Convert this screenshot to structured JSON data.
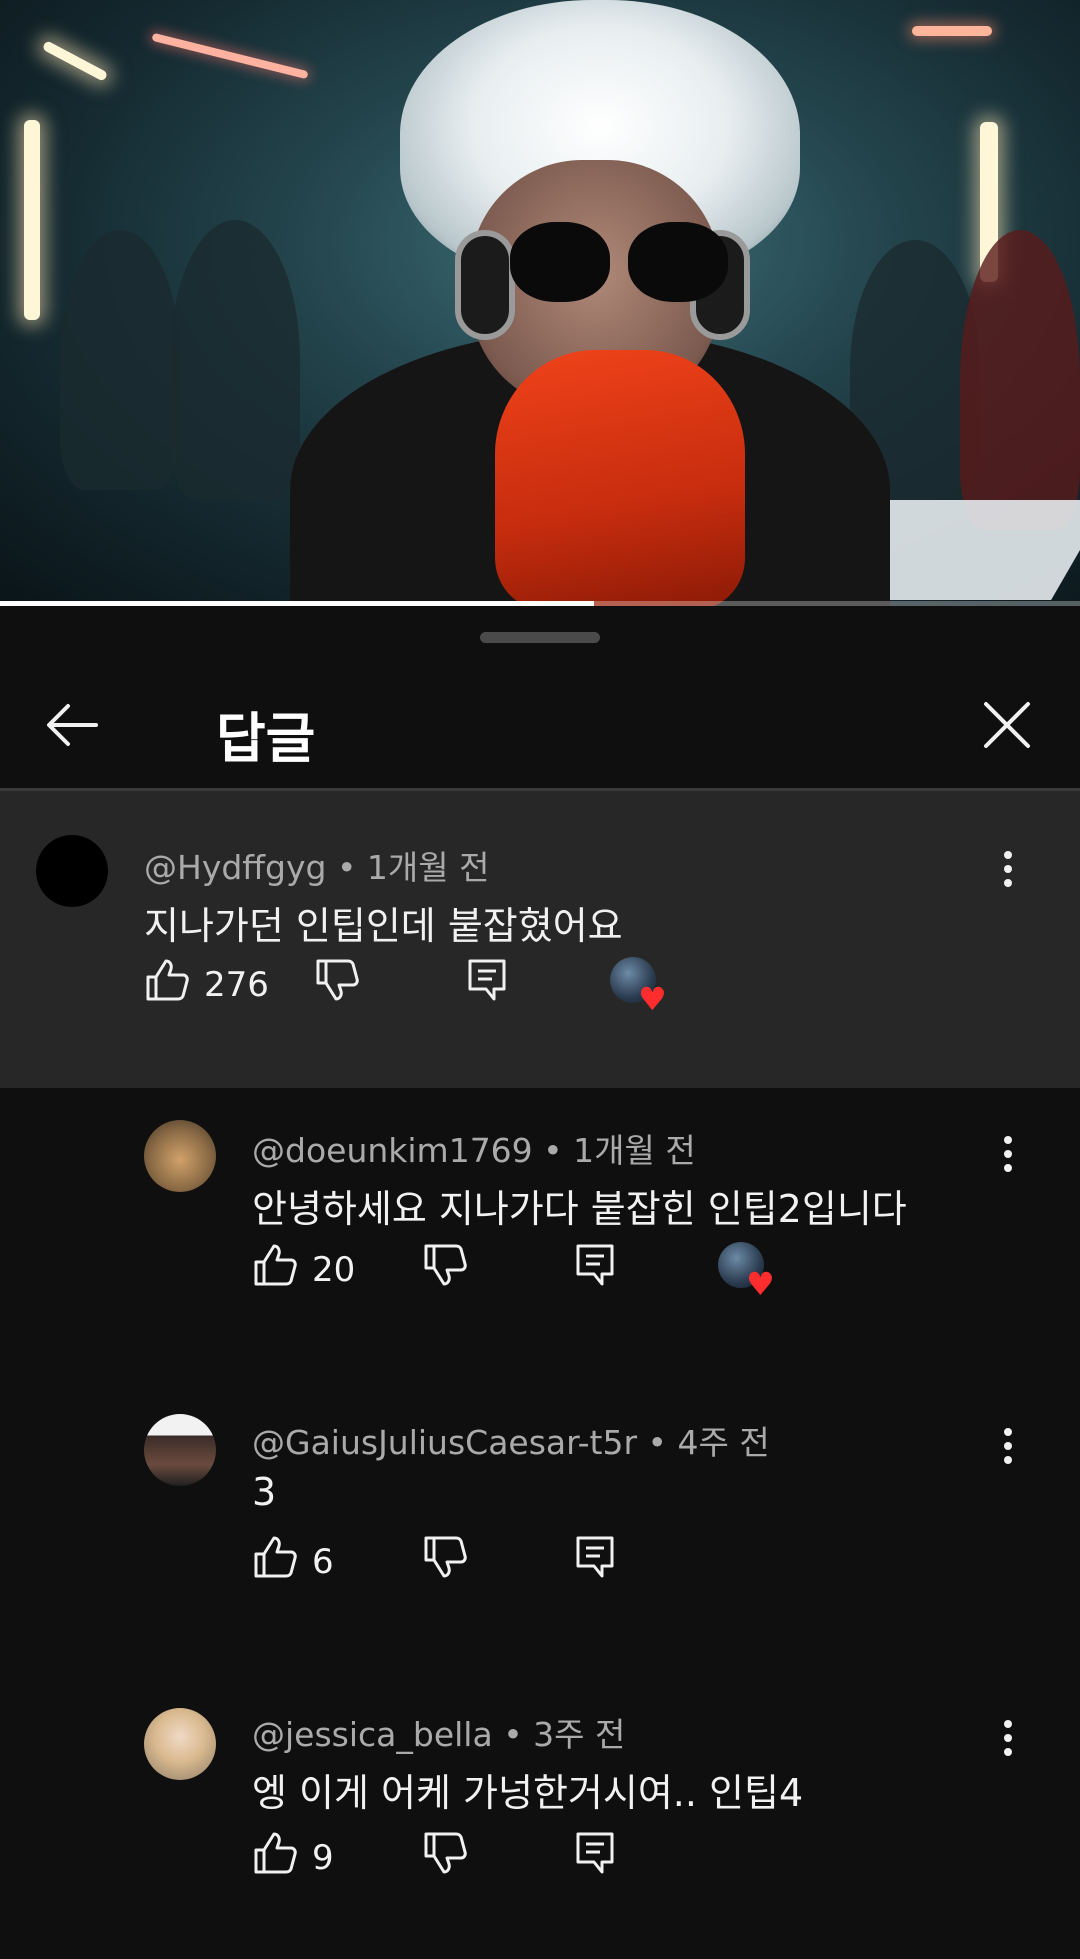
{
  "video": {
    "progress": 0.55
  },
  "sheet": {
    "title": "답글"
  },
  "parent_comment": {
    "author": "@Hydffgyg",
    "time": "1개월 전",
    "text": "지나가던 인팁인데 붙잡혔어요",
    "likes": "276",
    "hearted": true
  },
  "replies": [
    {
      "author": "@doeunkim1769",
      "time": "1개월 전",
      "text": "안녕하세요 지나가다 붙잡힌 인팁2입니다",
      "likes": "20",
      "hearted": true
    },
    {
      "author": "@GaiusJuliusCaesar-t5r",
      "time": "4주 전",
      "text": "3",
      "likes": "6",
      "hearted": false
    },
    {
      "author": "@jessica_bella",
      "time": "3주 전",
      "text": "엥 이게 어케 가넝한거시여.. 인팁4",
      "likes": "9",
      "hearted": false
    }
  ],
  "colors": {
    "background": "#0f0f0f",
    "highlight": "#272727",
    "meta": "#aaaaaa",
    "heart": "#ff2d2d"
  },
  "icons": [
    "back-arrow-icon",
    "close-icon",
    "thumbs-up-icon",
    "thumbs-down-icon",
    "reply-icon",
    "more-vertical-icon",
    "creator-heart-icon"
  ]
}
